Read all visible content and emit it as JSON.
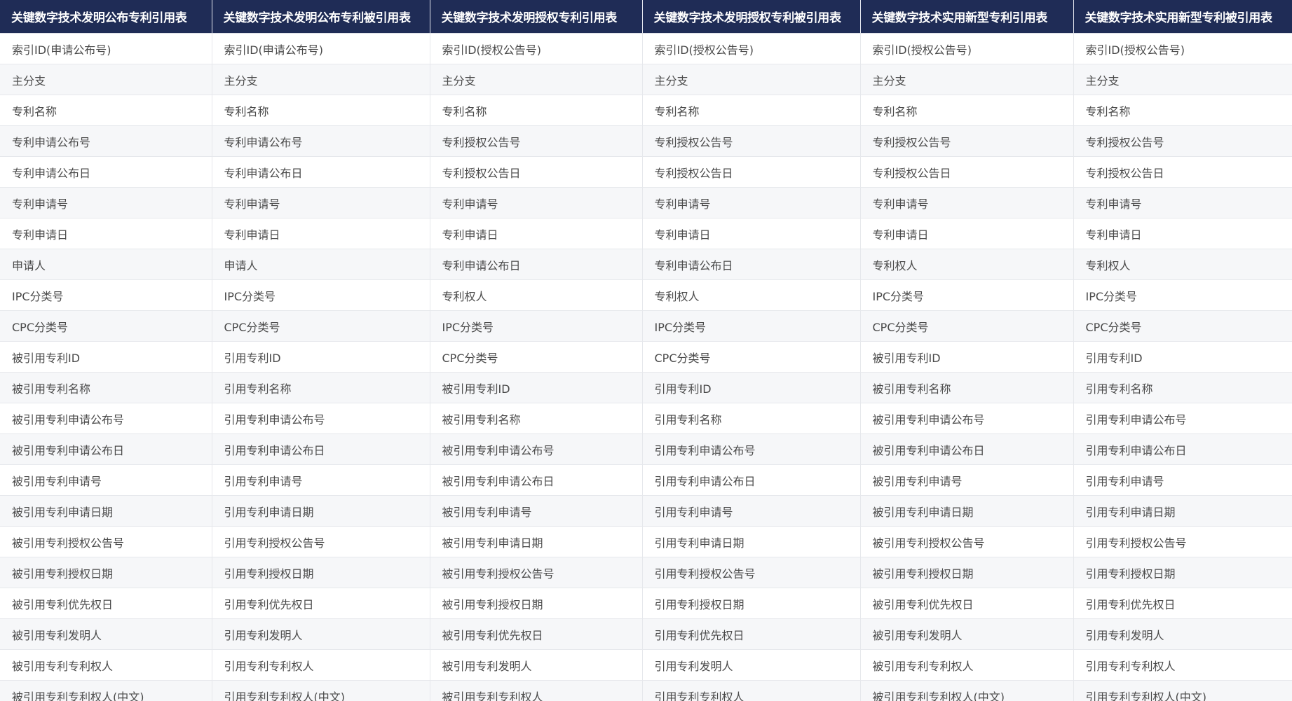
{
  "table": {
    "headers": [
      "关键数字技术发明公布专利引用表",
      "关键数字技术发明公布专利被引用表",
      "关键数字技术发明授权专利引用表",
      "关键数字技术发明授权专利被引用表",
      "关键数字技术实用新型专利引用表",
      "关键数字技术实用新型专利被引用表"
    ],
    "rows": [
      [
        "索引ID(申请公布号)",
        "索引ID(申请公布号)",
        "索引ID(授权公告号)",
        "索引ID(授权公告号)",
        "索引ID(授权公告号)",
        "索引ID(授权公告号)"
      ],
      [
        "主分支",
        "主分支",
        "主分支",
        "主分支",
        "主分支",
        "主分支"
      ],
      [
        "专利名称",
        "专利名称",
        "专利名称",
        "专利名称",
        "专利名称",
        "专利名称"
      ],
      [
        "专利申请公布号",
        "专利申请公布号",
        "专利授权公告号",
        "专利授权公告号",
        "专利授权公告号",
        "专利授权公告号"
      ],
      [
        "专利申请公布日",
        "专利申请公布日",
        "专利授权公告日",
        "专利授权公告日",
        "专利授权公告日",
        "专利授权公告日"
      ],
      [
        "专利申请号",
        "专利申请号",
        "专利申请号",
        "专利申请号",
        "专利申请号",
        "专利申请号"
      ],
      [
        "专利申请日",
        "专利申请日",
        "专利申请日",
        "专利申请日",
        "专利申请日",
        "专利申请日"
      ],
      [
        "申请人",
        "申请人",
        "专利申请公布日",
        "专利申请公布日",
        "专利权人",
        "专利权人"
      ],
      [
        "IPC分类号",
        "IPC分类号",
        "专利权人",
        "专利权人",
        "IPC分类号",
        "IPC分类号"
      ],
      [
        "CPC分类号",
        "CPC分类号",
        "IPC分类号",
        "IPC分类号",
        "CPC分类号",
        "CPC分类号"
      ],
      [
        "被引用专利ID",
        "引用专利ID",
        "CPC分类号",
        "CPC分类号",
        "被引用专利ID",
        "引用专利ID"
      ],
      [
        "被引用专利名称",
        "引用专利名称",
        "被引用专利ID",
        "引用专利ID",
        "被引用专利名称",
        "引用专利名称"
      ],
      [
        "被引用专利申请公布号",
        "引用专利申请公布号",
        "被引用专利名称",
        "引用专利名称",
        "被引用专利申请公布号",
        "引用专利申请公布号"
      ],
      [
        "被引用专利申请公布日",
        "引用专利申请公布日",
        "被引用专利申请公布号",
        "引用专利申请公布号",
        "被引用专利申请公布日",
        "引用专利申请公布日"
      ],
      [
        "被引用专利申请号",
        "引用专利申请号",
        "被引用专利申请公布日",
        "引用专利申请公布日",
        "被引用专利申请号",
        "引用专利申请号"
      ],
      [
        "被引用专利申请日期",
        "引用专利申请日期",
        "被引用专利申请号",
        "引用专利申请号",
        "被引用专利申请日期",
        "引用专利申请日期"
      ],
      [
        "被引用专利授权公告号",
        "引用专利授权公告号",
        "被引用专利申请日期",
        "引用专利申请日期",
        "被引用专利授权公告号",
        "引用专利授权公告号"
      ],
      [
        "被引用专利授权日期",
        "引用专利授权日期",
        "被引用专利授权公告号",
        "引用专利授权公告号",
        "被引用专利授权日期",
        "引用专利授权日期"
      ],
      [
        "被引用专利优先权日",
        "引用专利优先权日",
        "被引用专利授权日期",
        "引用专利授权日期",
        "被引用专利优先权日",
        "引用专利优先权日"
      ],
      [
        "被引用专利发明人",
        "引用专利发明人",
        "被引用专利优先权日",
        "引用专利优先权日",
        "被引用专利发明人",
        "引用专利发明人"
      ],
      [
        "被引用专利专利权人",
        "引用专利专利权人",
        "被引用专利发明人",
        "引用专利发明人",
        "被引用专利专利权人",
        "引用专利专利权人"
      ],
      [
        "被引用专利专利权人(中文)",
        "引用专利专利权人(中文)",
        "被引用专利专利权人",
        "引用专利专利权人",
        "被引用专利专利权人(中文)",
        "引用专利专利权人(中文)"
      ]
    ]
  }
}
